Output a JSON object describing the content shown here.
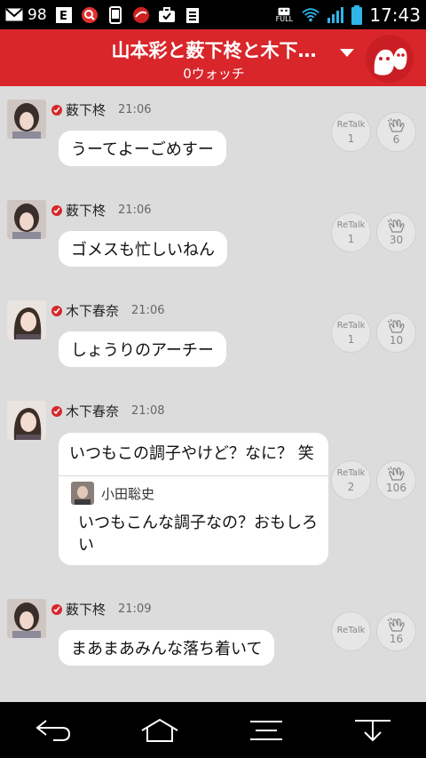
{
  "status_bar": {
    "notification_count": "98",
    "time": "17:43",
    "network_label": "FULL",
    "icons": [
      "mail-icon",
      "e-app-icon",
      "search-app-icon",
      "phone-icon",
      "app-icon",
      "briefcase-icon",
      "clipboard-icon",
      "robot-icon",
      "wifi-icon",
      "signal-icon",
      "battery-icon"
    ]
  },
  "header": {
    "title": "山本彩と薮下柊と木下…",
    "subtitle": "0ウォッチ",
    "accent_color": "#d8262b"
  },
  "messages": [
    {
      "name": "薮下柊",
      "time": "21:06",
      "text": "うーてよーごめすー",
      "retalk_label": "ReTalk",
      "retalk_count": "1",
      "like_count": "6"
    },
    {
      "name": "薮下柊",
      "time": "21:06",
      "text": "ゴメスも忙しいねん",
      "retalk_label": "ReTalk",
      "retalk_count": "1",
      "like_count": "30"
    },
    {
      "name": "木下春奈",
      "time": "21:06",
      "text": "しょうりのアーチー",
      "retalk_label": "ReTalk",
      "retalk_count": "1",
      "like_count": "10"
    },
    {
      "name": "木下春奈",
      "time": "21:08",
      "text": "いつもこの調子やけど？なに？ 笑",
      "retalk_label": "ReTalk",
      "retalk_count": "2",
      "like_count": "106",
      "quote": {
        "name": "小田聡史",
        "text": "いつもこんな調子なの？おもしろい"
      }
    },
    {
      "name": "薮下柊",
      "time": "21:09",
      "text": "まあまあみんな落ち着いて",
      "retalk_label": "ReTalk",
      "retalk_count": "",
      "like_count": "16"
    }
  ],
  "nav": {
    "icons": [
      "back-icon",
      "home-icon",
      "menu-icon",
      "download-icon"
    ]
  }
}
